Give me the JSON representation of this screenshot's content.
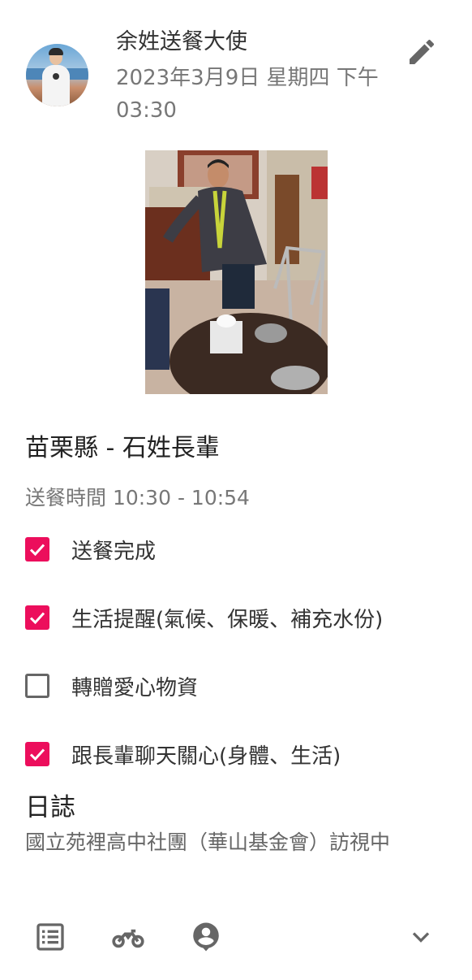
{
  "header": {
    "author": "余姓送餐大使",
    "datetime": "2023年3月9日 星期四 下午03:30",
    "edit_icon": "pencil-icon"
  },
  "content": {
    "title": "苗栗縣 - 石姓長輩",
    "delivery_time": "送餐時間 10:30 - 10:54",
    "checklist": [
      {
        "label": "送餐完成",
        "checked": true
      },
      {
        "label": "生活提醒(氣候、保暖、補充水份)",
        "checked": true
      },
      {
        "label": "轉贈愛心物資",
        "checked": false
      },
      {
        "label": "跟長輩聊天關心(身體、生活)",
        "checked": true
      }
    ]
  },
  "log": {
    "heading": "日誌",
    "text": "國立苑裡高中社團（華山基金會）訪視中"
  },
  "toolbar": {
    "icons": [
      "list-icon",
      "motorcycle-icon",
      "person-pin-icon",
      "chevron-down-icon"
    ]
  },
  "colors": {
    "accent": "#ec0e5c",
    "icon_gray": "#666666"
  }
}
